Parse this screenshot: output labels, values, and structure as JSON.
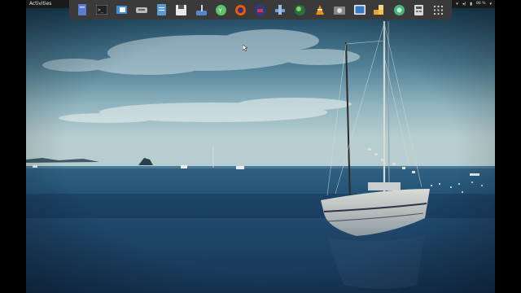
{
  "panel": {
    "activities_label": "Activities",
    "battery_percent": "86 %"
  },
  "dock": {
    "items": [
      {
        "icon": "files-blue-icon"
      },
      {
        "icon": "terminal-icon"
      },
      {
        "icon": "text-editor-icon"
      },
      {
        "icon": "devices-icon"
      },
      {
        "icon": "document-icon"
      },
      {
        "icon": "floppy-save-icon"
      },
      {
        "icon": "music-icon"
      },
      {
        "icon": "green-circle-app-icon"
      },
      {
        "icon": "firefox-icon"
      },
      {
        "icon": "vpn-shield-icon"
      },
      {
        "icon": "network-tools-icon"
      },
      {
        "icon": "globe-browser-icon"
      },
      {
        "icon": "vlc-cone-icon"
      },
      {
        "icon": "screenshot-icon"
      },
      {
        "icon": "image-viewer-icon"
      },
      {
        "icon": "puzzle-icon"
      },
      {
        "icon": "teal-app-icon"
      },
      {
        "icon": "calculator-icon"
      },
      {
        "icon": "app-grid-icon"
      }
    ]
  },
  "colors": {
    "panel_bg": "#1a1a1a",
    "dock_bg": "#3a3a3a",
    "sky_top": "#1e4a66",
    "sea": "#1a3f63"
  }
}
